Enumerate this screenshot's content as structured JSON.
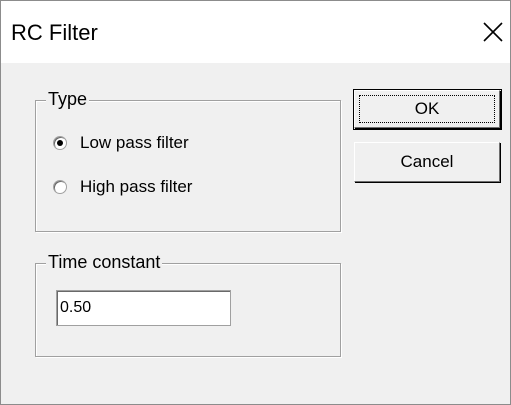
{
  "window": {
    "title": "RC Filter"
  },
  "type_group": {
    "legend": "Type",
    "options": [
      {
        "label": "Low pass filter",
        "selected": true
      },
      {
        "label": "High pass filter",
        "selected": false
      }
    ]
  },
  "time_group": {
    "legend": "Time constant",
    "value": "0.50"
  },
  "buttons": {
    "ok_label": "OK",
    "cancel_label": "Cancel"
  },
  "icons": {
    "close": "close-icon"
  }
}
